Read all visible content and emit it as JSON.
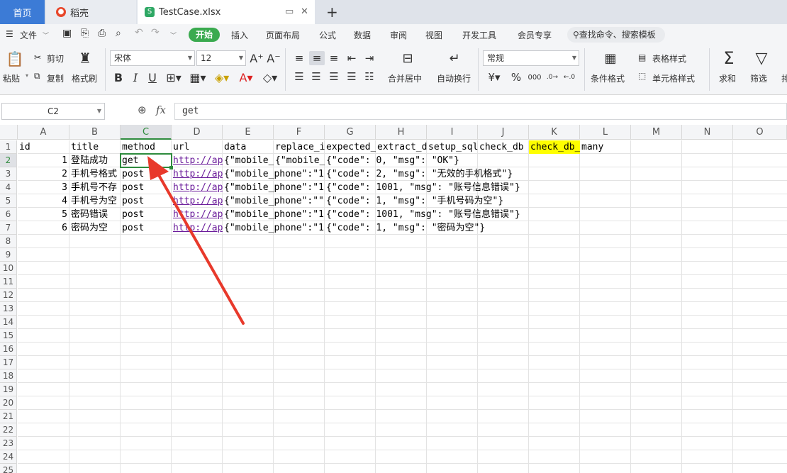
{
  "tabs": {
    "home": "首页",
    "daoke": "稻壳",
    "file": "TestCase.xlsx",
    "file_icon": "S",
    "new_tab": "+"
  },
  "menu": {
    "file": "文件",
    "items": [
      "开始",
      "插入",
      "页面布局",
      "公式",
      "数据",
      "审阅",
      "视图",
      "开发工具",
      "会员专享"
    ],
    "search": "查找命令、搜索模板"
  },
  "ribbon": {
    "paste": "粘贴",
    "cut": "剪切",
    "copy": "复制",
    "format_painter": "格式刷",
    "font": "宋体",
    "size": "12",
    "bold": "B",
    "italic": "I",
    "underline": "U",
    "merge": "合并居中",
    "wrap": "自动换行",
    "num_format": "常规",
    "cond_format": "条件格式",
    "table_style": "表格样式",
    "cell_style": "单元格样式",
    "sum": "求和",
    "filter": "筛选",
    "sort_partial": "排"
  },
  "formula": {
    "cell_ref": "C2",
    "fx": "fx",
    "value": "get"
  },
  "columns": [
    "A",
    "B",
    "C",
    "D",
    "E",
    "F",
    "G",
    "H",
    "I",
    "J",
    "K",
    "L",
    "M",
    "N",
    "O"
  ],
  "rows": [
    "1",
    "2",
    "3",
    "4",
    "5",
    "6",
    "7",
    "8",
    "9",
    "10",
    "11",
    "12",
    "13",
    "14",
    "15",
    "16",
    "17",
    "18",
    "19",
    "20",
    "21",
    "22",
    "23",
    "24",
    "25"
  ],
  "cells": {
    "header": [
      "id",
      "title",
      "method",
      "url",
      "data",
      "replace_i",
      "expected_",
      "extract_d",
      "setup_sql",
      "check_db",
      "check_db_",
      "many"
    ],
    "r2": {
      "id": "1",
      "title": "登陆成功",
      "method": "get",
      "url": "http://ap",
      "data": "{\"mobile_",
      "replace": "{\"mobile_",
      "expected": "{\"code\": 0, \"msg\": \"OK\"}"
    },
    "r3": {
      "id": "2",
      "title": "手机号格式",
      "method": "post",
      "url": "http://ap",
      "data": "{\"mobile_phone\":\"1",
      "expected": "{\"code\": 2, \"msg\": \"无效的手机格式\"}"
    },
    "r4": {
      "id": "3",
      "title": "手机号不存",
      "method": "post",
      "url": "http://ap",
      "data": "{\"mobile_phone\":\"1",
      "expected": "{\"code\": 1001, \"msg\": \"账号信息错误\"}"
    },
    "r5": {
      "id": "4",
      "title": "手机号为空",
      "method": "post",
      "url": "http://ap",
      "data": "{\"mobile_phone\":\"\"",
      "expected": "{\"code\": 1, \"msg\": \"手机号码为空\"}"
    },
    "r6": {
      "id": "5",
      "title": "密码错误",
      "method": "post",
      "url": "http://ap",
      "data": "{\"mobile_phone\":\"1",
      "expected": "{\"code\": 1001, \"msg\": \"账号信息错误\"}"
    },
    "r7": {
      "id": "6",
      "title": "密码为空",
      "method": "post",
      "url": "http://ap",
      "data": "{\"mobile_phone\":\"1",
      "expected": "{\"code\": 1, \"msg\": \"密码为空\"}"
    }
  },
  "colors": {
    "accent": "#3aaa4f",
    "selection": "#2e8b3d",
    "highlight": "#ffff00",
    "annotation_arrow": "#e8392b"
  }
}
